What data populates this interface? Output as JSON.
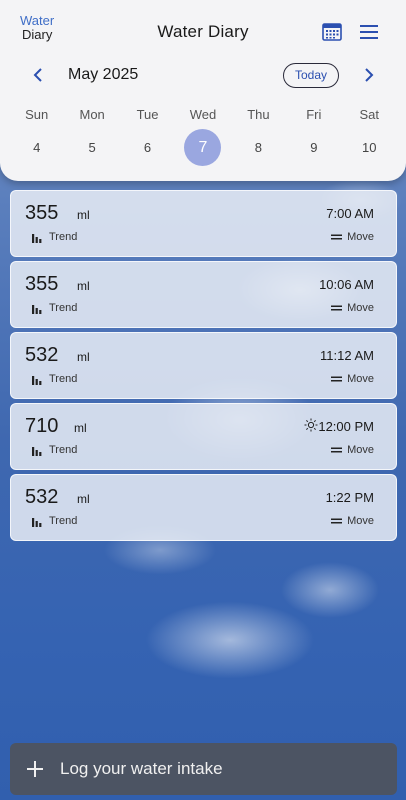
{
  "logo": {
    "line1": "Water",
    "line2": "Diary"
  },
  "header": {
    "title": "Water Diary",
    "calendar_icon": "calendar-icon",
    "menu_icon": "hamburger-menu-icon"
  },
  "calendar": {
    "month": "May 2025",
    "today_label": "Today",
    "weekdays": [
      "Sun",
      "Mon",
      "Tue",
      "Wed",
      "Thu",
      "Fri",
      "Sat"
    ],
    "days": [
      "4",
      "5",
      "6",
      "7",
      "8",
      "9",
      "10"
    ],
    "selected_day": "7",
    "accent_color": "#9aa7e0"
  },
  "entries": [
    {
      "amount": "355",
      "unit": "ml",
      "time": "7:00 AM",
      "trend_label": "Trend",
      "move_label": "Move",
      "icon": ""
    },
    {
      "amount": "355",
      "unit": "ml",
      "time": "10:06 AM",
      "trend_label": "Trend",
      "move_label": "Move",
      "icon": ""
    },
    {
      "amount": "532",
      "unit": "ml",
      "time": "11:12 AM",
      "trend_label": "Trend",
      "move_label": "Move",
      "icon": ""
    },
    {
      "amount": "710",
      "unit": "ml",
      "time": "12:00 PM",
      "trend_label": "Trend",
      "move_label": "Move",
      "icon": "sun-icon"
    },
    {
      "amount": "532",
      "unit": "ml",
      "time": "1:22 PM",
      "trend_label": "Trend",
      "move_label": "Move",
      "icon": ""
    }
  ],
  "log_bar": {
    "label": "Log your water intake",
    "icon": "plus-icon"
  }
}
